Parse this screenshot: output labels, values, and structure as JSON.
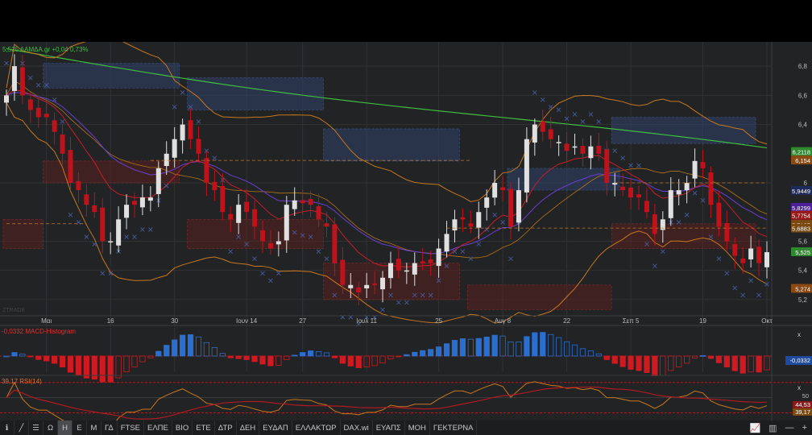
{
  "header": {
    "quote": "5,525 ΛΑΜΔΑ.gr +0,04 0,73%"
  },
  "watermark": "ZTRADE",
  "chart_data": {
    "type": "candlestick",
    "symbol": "ΛΑΜΔΑ.gr",
    "ylim": [
      5.1,
      6.95
    ],
    "y_ticks": [
      "6,8",
      "6,6",
      "6,4",
      "6",
      "5,6",
      "5,4",
      "5,2"
    ],
    "y_tick_values": [
      6.8,
      6.6,
      6.4,
      6.0,
      5.6,
      5.4,
      5.2
    ],
    "x_labels": [
      "Μαι",
      "16",
      "30",
      "Ιουν 14",
      "27",
      "Ιουλ 11",
      "25",
      "Αυγ 8",
      "22",
      "Σεπ 5",
      "19",
      "Οκτ"
    ],
    "x_label_index": [
      5,
      13,
      21,
      30,
      37,
      45,
      54,
      62,
      70,
      78,
      87,
      95
    ],
    "closes": [
      6.6,
      6.8,
      6.6,
      6.5,
      6.45,
      6.45,
      6.35,
      6.2,
      6.0,
      5.95,
      5.85,
      5.8,
      5.6,
      5.6,
      5.75,
      5.85,
      5.85,
      5.9,
      5.9,
      6.1,
      6.2,
      6.3,
      6.4,
      6.3,
      6.2,
      6.0,
      5.95,
      5.8,
      5.75,
      5.85,
      5.8,
      5.7,
      5.6,
      5.55,
      5.6,
      5.85,
      5.88,
      5.86,
      5.85,
      5.75,
      5.7,
      5.45,
      5.3,
      5.3,
      5.25,
      5.3,
      5.3,
      5.35,
      5.45,
      5.4,
      5.4,
      5.45,
      5.45,
      5.45,
      5.55,
      5.65,
      5.75,
      5.75,
      5.7,
      5.8,
      5.9,
      6.0,
      5.95,
      5.7,
      5.95,
      6.3,
      6.4,
      6.35,
      6.3,
      6.28,
      6.22,
      6.25,
      6.2,
      6.25,
      6.2,
      6.0,
      6.0,
      5.95,
      5.9,
      5.9,
      5.8,
      5.65,
      5.75,
      5.95,
      5.95,
      6.0,
      6.15,
      6.1,
      5.85,
      5.7,
      5.6,
      5.5,
      5.45,
      5.55,
      5.45,
      5.525
    ],
    "zones": [
      {
        "kind": "supply",
        "from": 5,
        "to": 22,
        "low": 6.65,
        "high": 6.82
      },
      {
        "kind": "supply",
        "from": 23,
        "to": 40,
        "low": 6.5,
        "high": 6.72
      },
      {
        "kind": "supply",
        "from": 40,
        "to": 57,
        "low": 6.15,
        "high": 6.37
      },
      {
        "kind": "supply",
        "from": 63,
        "to": 77,
        "low": 5.95,
        "high": 6.1
      },
      {
        "kind": "supply",
        "from": 76,
        "to": 94,
        "low": 6.27,
        "high": 6.45
      },
      {
        "kind": "demand",
        "from": 5,
        "to": 22,
        "low": 6.0,
        "high": 6.15
      },
      {
        "kind": "demand",
        "from": 0,
        "to": 5,
        "low": 5.55,
        "high": 5.75
      },
      {
        "kind": "demand",
        "from": 23,
        "to": 40,
        "low": 5.55,
        "high": 5.75
      },
      {
        "kind": "demand",
        "from": 40,
        "to": 57,
        "low": 5.2,
        "high": 5.45
      },
      {
        "kind": "demand",
        "from": 58,
        "to": 76,
        "low": 5.13,
        "high": 5.3
      },
      {
        "kind": "demand",
        "from": 76,
        "to": 94,
        "low": 5.55,
        "high": 5.72
      }
    ],
    "price_badges": [
      {
        "label": "6,2118",
        "value": 6.2118,
        "color": "#2f8a2f"
      },
      {
        "label": "6,154",
        "value": 6.154,
        "color": "#8a4a12"
      },
      {
        "label": "5,9449",
        "value": 5.9449,
        "color": "#1e2a5a"
      },
      {
        "label": "5,8299",
        "value": 5.8299,
        "color": "#4b1f9a"
      },
      {
        "label": "5,7754",
        "value": 5.7754,
        "color": "#9a1a1a"
      },
      {
        "label": "5,7127",
        "value": 5.7127,
        "color": "#7a4a10"
      },
      {
        "label": "5,6883",
        "value": 5.6883,
        "color": "#7a4a10"
      },
      {
        "label": "5,525",
        "value": 5.525,
        "color": "#2f8a2f"
      },
      {
        "label": "5,274",
        "value": 5.274,
        "color": "#8a4a12"
      }
    ],
    "macd": {
      "label": "-0,0332 MACD-Histogram",
      "value_badge": "-0,0332",
      "close_label": "x"
    },
    "rsi": {
      "label": "39,17 RSI(14)",
      "level": "50",
      "badges": [
        "44,53",
        "39,17"
      ],
      "close_label": "x"
    },
    "colors": {
      "up": "#e0e0e0",
      "down": "#c0121a",
      "ma200": "#3fbf3f",
      "bb": "#c8781e",
      "ma_purple": "#6a3fd0",
      "ma_red": "#c81e2a",
      "macd_pos": "#2a6fd0",
      "macd_neg": "#d01a22"
    }
  },
  "toolbar": {
    "items": [
      "Ω",
      "Η",
      "Ε",
      "Μ",
      "ΓΔ",
      "FTSE",
      "ΕΛΠΕ",
      "ΒΙΟ",
      "ΕΤΕ",
      "ΔΤΡ",
      "ΔΕΗ",
      "ΕΥΔΑΠ",
      "ΕΛΛΑΚΤΩΡ",
      "DAX.wi",
      "ΕΥΑΠΣ",
      "ΜΟΗ",
      "ΓΕΚΤΕΡΝΑ"
    ],
    "active": "Η"
  }
}
